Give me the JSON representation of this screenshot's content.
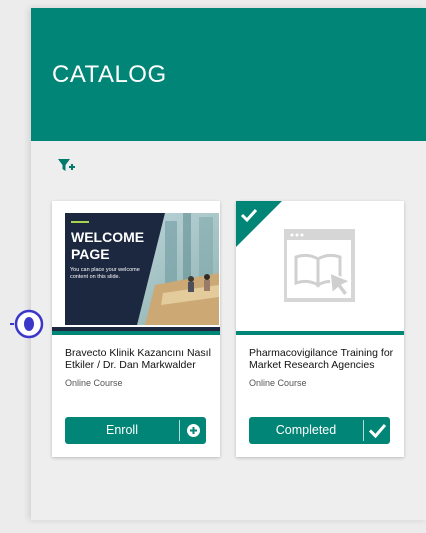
{
  "catalog": {
    "title": "CATALOG"
  },
  "icons": {
    "filter": "filter-plus-icon",
    "enroll": "plus-circle-icon",
    "completed": "checkmark-icon",
    "placeholder": "course-placeholder-icon"
  },
  "courses": [
    {
      "title": "Bravecto Klinik Kazancını Nasıl Etkiler / Dr. Dan Markwalder",
      "type": "Online Course",
      "action_label": "Enroll",
      "thumbnail": {
        "heading_line1": "WELCOME",
        "heading_line2": "PAGE",
        "subtext": "You can place your welcome content on this slide."
      }
    },
    {
      "title": "Pharmacovigilance Training for Market Research Agencies",
      "type": "Online Course",
      "action_label": "Completed",
      "completed": true
    }
  ],
  "colors": {
    "brand": "#008577",
    "navy": "#1c2740",
    "indicator": "#3b38c9"
  }
}
